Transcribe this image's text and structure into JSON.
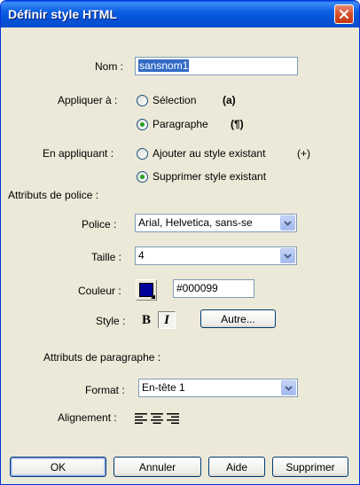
{
  "window": {
    "title": "Définir style HTML"
  },
  "name_row": {
    "label": "Nom :",
    "value": "sansnom1"
  },
  "apply_to": {
    "label": "Appliquer à :",
    "options": [
      {
        "label": "Sélection",
        "shortcut": "(a)",
        "checked": false
      },
      {
        "label": "Paragraphe",
        "shortcut": "(¶)",
        "checked": true
      }
    ]
  },
  "when_applying": {
    "label": "En appliquant :",
    "options": [
      {
        "label": "Ajouter au style existant",
        "shortcut": "(+)",
        "checked": false
      },
      {
        "label": "Supprimer style existant",
        "shortcut": "",
        "checked": true
      }
    ]
  },
  "font_attrs": {
    "heading": "Attributs de police :",
    "font_label": "Police :",
    "font_value": "Arial, Helvetica, sans-se",
    "size_label": "Taille :",
    "size_value": "4",
    "color_label": "Couleur :",
    "color_value": "#000099",
    "style_label": "Style :",
    "bold_glyph": "B",
    "italic_glyph": "I",
    "other_button": "Autre..."
  },
  "para_attrs": {
    "heading": "Attributs de paragraphe :",
    "format_label": "Format :",
    "format_value": "En-tête 1",
    "align_label": "Alignement :"
  },
  "buttons": {
    "ok": "OK",
    "cancel": "Annuler",
    "help": "Aide",
    "delete": "Supprimer"
  },
  "colors": {
    "swatch": "#000099",
    "titlebar": "#0552d6",
    "close": "#d44a22",
    "radio_dot": "#21a121"
  }
}
